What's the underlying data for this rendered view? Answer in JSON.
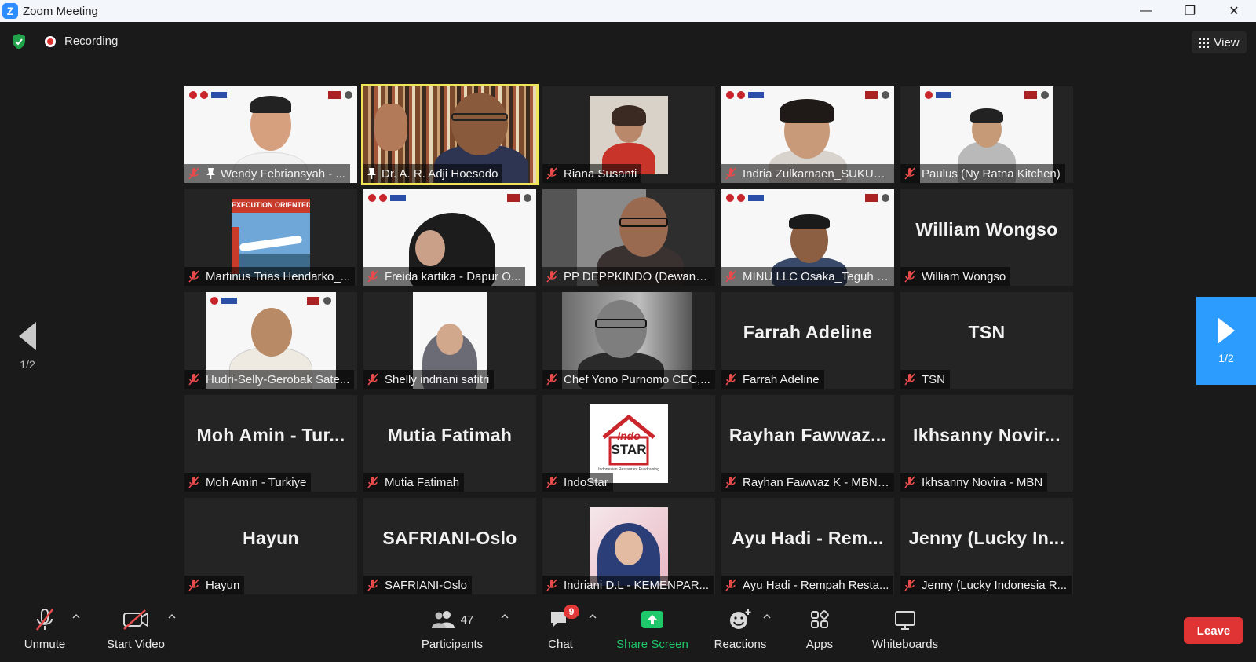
{
  "window": {
    "title": "Zoom Meeting",
    "minimize": "—",
    "restore": "❐",
    "close": "✕"
  },
  "topbar": {
    "recording_label": "Recording",
    "view_label": "View"
  },
  "paging": {
    "prev_label": "1/2",
    "next_label": "1/2"
  },
  "tiles": [
    {
      "name": "Wendy Febriansyah - ...",
      "pinned": true
    },
    {
      "name": "Dr. A. R. Adji Hoesodo",
      "pinned": true,
      "speaking": true
    },
    {
      "name": "Riana Susanti"
    },
    {
      "name": "Indria Zulkarnaen_SUKU_..."
    },
    {
      "name": "Paulus (Ny Ratna Kitchen)"
    },
    {
      "name": "Martinus Trias Hendarko_...",
      "video_caption": "EXECUTION ORIENTED"
    },
    {
      "name": "Freida kartika - Dapur O..."
    },
    {
      "name": "PP DEPPKINDO (Dewan P..."
    },
    {
      "name": "MINU LLC Osaka_Teguh S..."
    },
    {
      "name": "William Wongso",
      "display": "William Wongso"
    },
    {
      "name": "Hudri-Selly-Gerobak Sate..."
    },
    {
      "name": "Shelly indriani safitri"
    },
    {
      "name": "Chef Yono Purnomo CEC,..."
    },
    {
      "name": "Farrah Adeline",
      "display": "Farrah Adeline"
    },
    {
      "name": "TSN",
      "display": "TSN"
    },
    {
      "name": "Moh Amin - Turkiye",
      "display": "Moh Amin - Tur..."
    },
    {
      "name": "Mutia Fatimah",
      "display": "Mutia Fatimah"
    },
    {
      "name": "IndoStar",
      "logo_text": "STAR",
      "logo_sub": "Indonesian Restaurant Fundraising",
      "logo_top": "Indo"
    },
    {
      "name": "Rayhan Fawwaz K - MBN ...",
      "display": "Rayhan Fawwaz..."
    },
    {
      "name": "Ikhsanny Novira - MBN",
      "display": "Ikhsanny Novir..."
    },
    {
      "name": "Hayun",
      "display": "Hayun"
    },
    {
      "name": "SAFRIANI-Oslo",
      "display": "SAFRIANI-Oslo"
    },
    {
      "name": "Indriani D.L - KEMENPAR..."
    },
    {
      "name": "Ayu Hadi - Rempah Resta...",
      "display": "Ayu Hadi - Rem..."
    },
    {
      "name": "Jenny (Lucky Indonesia R...",
      "display": "Jenny (Lucky In..."
    }
  ],
  "toolbar": {
    "unmute": "Unmute",
    "start_video": "Start Video",
    "participants": "Participants",
    "participants_count": "47",
    "chat": "Chat",
    "chat_badge": "9",
    "share_screen": "Share Screen",
    "reactions": "Reactions",
    "apps": "Apps",
    "whiteboards": "Whiteboards",
    "leave": "Leave"
  },
  "colors": {
    "accent": "#2d9cff",
    "share": "#1fc86a",
    "leave": "#e03333",
    "speaker_outline": "#f0e556"
  }
}
